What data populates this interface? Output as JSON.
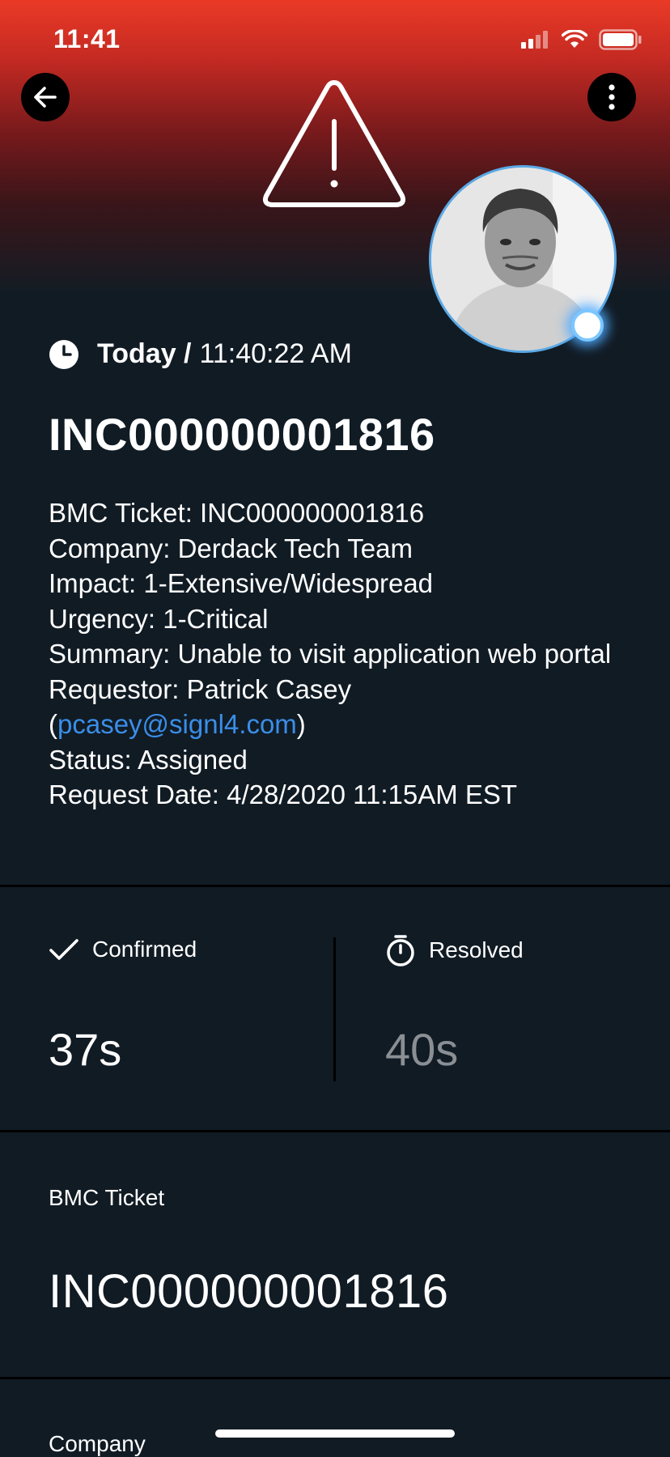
{
  "status_bar": {
    "time": "11:41"
  },
  "alert": {
    "timestamp_day": "Today /",
    "timestamp_time": "11:40:22 AM",
    "title": "INC000000001816",
    "details": {
      "ticket": "BMC Ticket: INC000000001816",
      "company": "Company: Derdack Tech Team",
      "impact": "Impact: 1-Extensive/Widespread",
      "urgency": "Urgency: 1-Critical",
      "summary": "Summary: Unable to visit application web portal",
      "requestor": "Requestor: Patrick Casey",
      "requestor_email_open": "(",
      "requestor_email": "pcasey@signl4.com",
      "requestor_email_close": ")",
      "status": "Status: Assigned",
      "request_date": "Request Date: 4/28/2020 11:15AM EST"
    }
  },
  "stats": {
    "confirmed_label": "Confirmed",
    "confirmed_value": "37s",
    "resolved_label": "Resolved",
    "resolved_value": "40s"
  },
  "fields": [
    {
      "label": "BMC Ticket",
      "value": "INC000000001816"
    },
    {
      "label": "Company"
    }
  ],
  "colors": {
    "header_top": "#ea3a27",
    "background": "#111b24",
    "link": "#3a8ee8",
    "presence": "#7cc6ff",
    "muted_value": "#8a8f94"
  },
  "icons": [
    "back-arrow-icon",
    "more-vertical-icon",
    "warning-triangle-icon",
    "clock-icon",
    "checkmark-icon",
    "stopwatch-icon",
    "signal-icon",
    "wifi-icon",
    "battery-icon"
  ]
}
